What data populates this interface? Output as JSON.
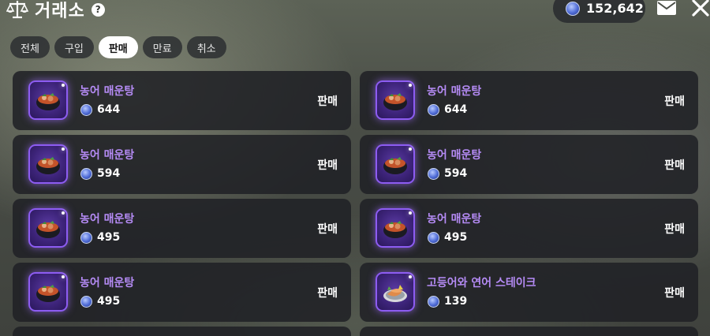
{
  "header": {
    "title": "거래소",
    "help_label": "?",
    "currency_amount": "152,642"
  },
  "tabs": [
    {
      "label": "전체",
      "active": false
    },
    {
      "label": "구입",
      "active": false
    },
    {
      "label": "판매",
      "active": true
    },
    {
      "label": "만료",
      "active": false
    },
    {
      "label": "취소",
      "active": false
    }
  ],
  "listings": [
    {
      "name": "농어 매운탕",
      "price": "644",
      "status": "판매",
      "icon": "spicy-fish-stew-icon"
    },
    {
      "name": "농어 매운탕",
      "price": "644",
      "status": "판매",
      "icon": "spicy-fish-stew-icon"
    },
    {
      "name": "농어 매운탕",
      "price": "594",
      "status": "판매",
      "icon": "spicy-fish-stew-icon"
    },
    {
      "name": "농어 매운탕",
      "price": "594",
      "status": "판매",
      "icon": "spicy-fish-stew-icon"
    },
    {
      "name": "농어 매운탕",
      "price": "495",
      "status": "판매",
      "icon": "spicy-fish-stew-icon"
    },
    {
      "name": "농어 매운탕",
      "price": "495",
      "status": "판매",
      "icon": "spicy-fish-stew-icon"
    },
    {
      "name": "농어 매운탕",
      "price": "495",
      "status": "판매",
      "icon": "spicy-fish-stew-icon"
    },
    {
      "name": "고등어와 연어 스테이크",
      "price": "139",
      "status": "판매",
      "icon": "fish-steak-icon"
    }
  ],
  "colors": {
    "item_name": "#b58bf5",
    "icon_border": "#8d5cf2",
    "card_bg": "#202125",
    "active_tab_bg": "#ffffff"
  },
  "icons": {
    "title": "scale-icon",
    "currency": "coin-icon",
    "mail": "mail-icon",
    "close": "close-icon"
  }
}
